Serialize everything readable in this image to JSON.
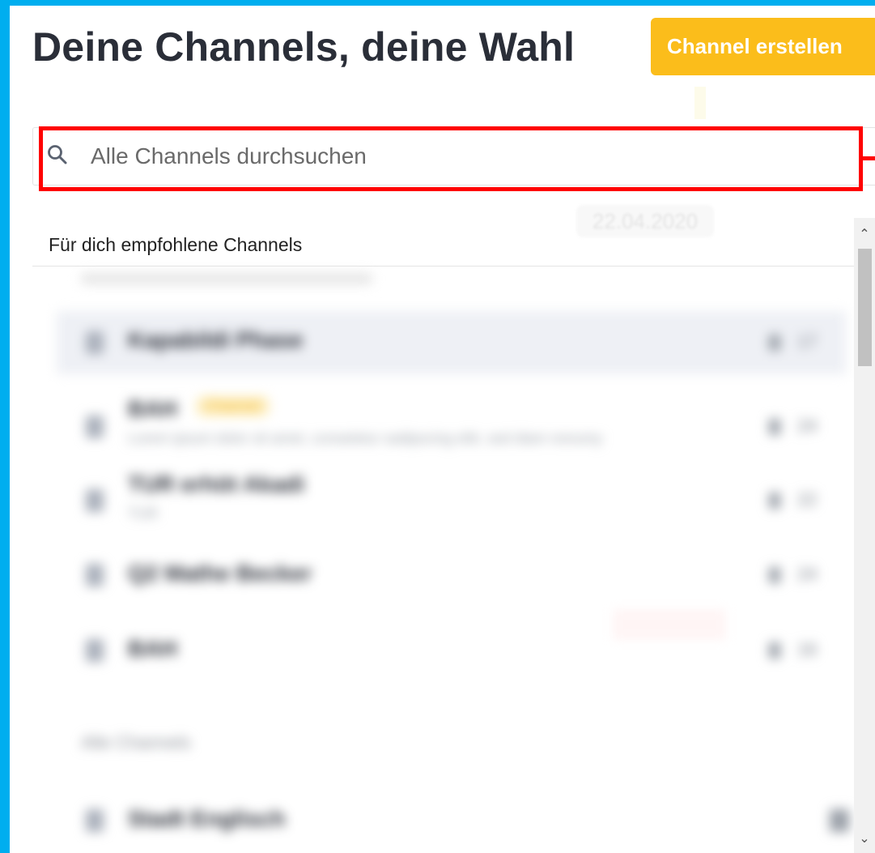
{
  "header": {
    "title": "Deine Channels, deine Wahl",
    "create_button": "Channel erstellen"
  },
  "search": {
    "placeholder": "Alle Channels durchsuchen",
    "value": ""
  },
  "background_date": "22.04.2020",
  "recommended": {
    "label": "Für dich empfohlene Channels",
    "channels": [
      {
        "name": "Kapabildi Phase",
        "subtitle": "",
        "badge": "",
        "count": "17",
        "active": true
      },
      {
        "name": "BAH",
        "subtitle": "Lorem ipsum dolor sit amet, consetetur sadipscing elitr, sed diam nonumy",
        "badge": "Channel",
        "count": "24",
        "active": false
      },
      {
        "name": "TUR erhöt Akadi",
        "subtitle": "TUR",
        "badge": "",
        "count": "22",
        "active": false
      },
      {
        "name": "Q2 Mathe Becker",
        "subtitle": "",
        "badge": "",
        "count": "24",
        "active": false
      },
      {
        "name": "BAH",
        "subtitle": "",
        "badge": "",
        "count": "16",
        "active": false
      }
    ]
  },
  "all_channels": {
    "label": "Alle Channels",
    "channels": [
      {
        "name": "Stadt Englisch",
        "subtitle": "",
        "badge": "",
        "count": "",
        "active": false
      }
    ]
  },
  "scrollbar": {
    "up": "^",
    "down": "v"
  },
  "colors": {
    "frame": "#00aeef",
    "accent": "#fbbd1b",
    "highlight": "#ff0000",
    "title": "#2a2e38"
  }
}
